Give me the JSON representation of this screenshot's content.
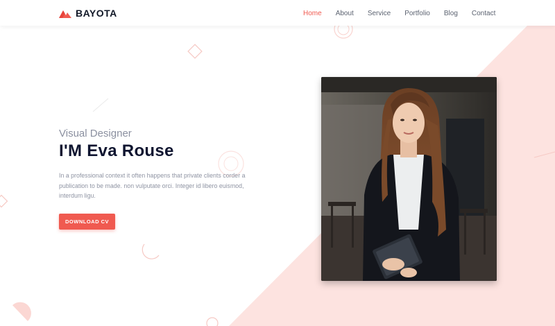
{
  "brand": {
    "name": "BAYOTA",
    "accent_color": "#f05a50",
    "icon": "mountain-logo-icon"
  },
  "nav": {
    "items": [
      {
        "label": "Home",
        "active": true
      },
      {
        "label": "About",
        "active": false
      },
      {
        "label": "Service",
        "active": false
      },
      {
        "label": "Portfolio",
        "active": false
      },
      {
        "label": "Blog",
        "active": false
      },
      {
        "label": "Contact",
        "active": false
      }
    ]
  },
  "hero": {
    "subtitle": "Visual Designer",
    "title": "I'M Eva Rouse",
    "description": "In a professional context it often happens that private clients corder a publication to be made. non vulputate orci. Integer id libero euismod, interdum ligu.",
    "button_label": "DOWNLOAD CV"
  },
  "colors": {
    "accent": "#f05a50",
    "background_shape": "#fde4e1",
    "heading": "#0f1530",
    "muted_text": "#8f94a3"
  }
}
